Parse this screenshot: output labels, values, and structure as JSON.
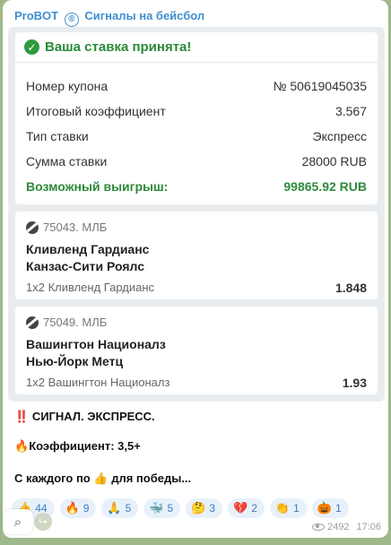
{
  "channel": {
    "name": "ProBOT",
    "symbol": "®",
    "title": "Сигналы на бейсбол"
  },
  "bet": {
    "header": "Ваша ставка принята!",
    "rows": [
      {
        "label": "Номер купона",
        "value": "№ 50619045035"
      },
      {
        "label": "Итоговый коэффициент",
        "value": "3.567"
      },
      {
        "label": "Тип ставки",
        "value": "Экспресс"
      },
      {
        "label": "Сумма ставки",
        "value": "28000 RUB"
      }
    ],
    "win": {
      "label": "Возможный выигрыш:",
      "value": "99865.92 RUB"
    }
  },
  "events": [
    {
      "id": "75043. МЛБ",
      "team1": "Кливленд Гардианс",
      "team2": "Канзас-Сити Роялс",
      "outcome": "1х2 Кливленд Гардианс",
      "odd": "1.848"
    },
    {
      "id": "75049. МЛБ",
      "team1": "Вашингтон Националз",
      "team2": "Нью-Йорк Метц",
      "outcome": "1х2 Вашингтон Националз",
      "odd": "1.93"
    }
  ],
  "message": {
    "line1_icon": "‼️",
    "line1": "СИГНАЛ. ЭКСПРЕСС.",
    "line2_icon": "🔥",
    "line2": "Коэффициент: 3,5+",
    "line3": "С каждого по",
    "line3_icon": "👍",
    "line3_end": "для победы..."
  },
  "reactions": [
    {
      "emoji": "👍",
      "count": "44"
    },
    {
      "emoji": "🔥",
      "count": "9"
    },
    {
      "emoji": "🙏",
      "count": "5"
    },
    {
      "emoji": "🐳",
      "count": "5"
    },
    {
      "emoji": "🤔",
      "count": "3"
    },
    {
      "emoji": "💔",
      "count": "2"
    },
    {
      "emoji": "👏",
      "count": "1"
    },
    {
      "emoji": "🎃",
      "count": "1"
    }
  ],
  "meta": {
    "views": "2492",
    "time": "17:06"
  },
  "icons": {
    "attach": "attach-icon",
    "share": "share-icon",
    "check": "check-icon",
    "ball": "baseball-icon"
  },
  "colors": {
    "accent": "#3e8fd0",
    "success": "#2a8a38"
  }
}
